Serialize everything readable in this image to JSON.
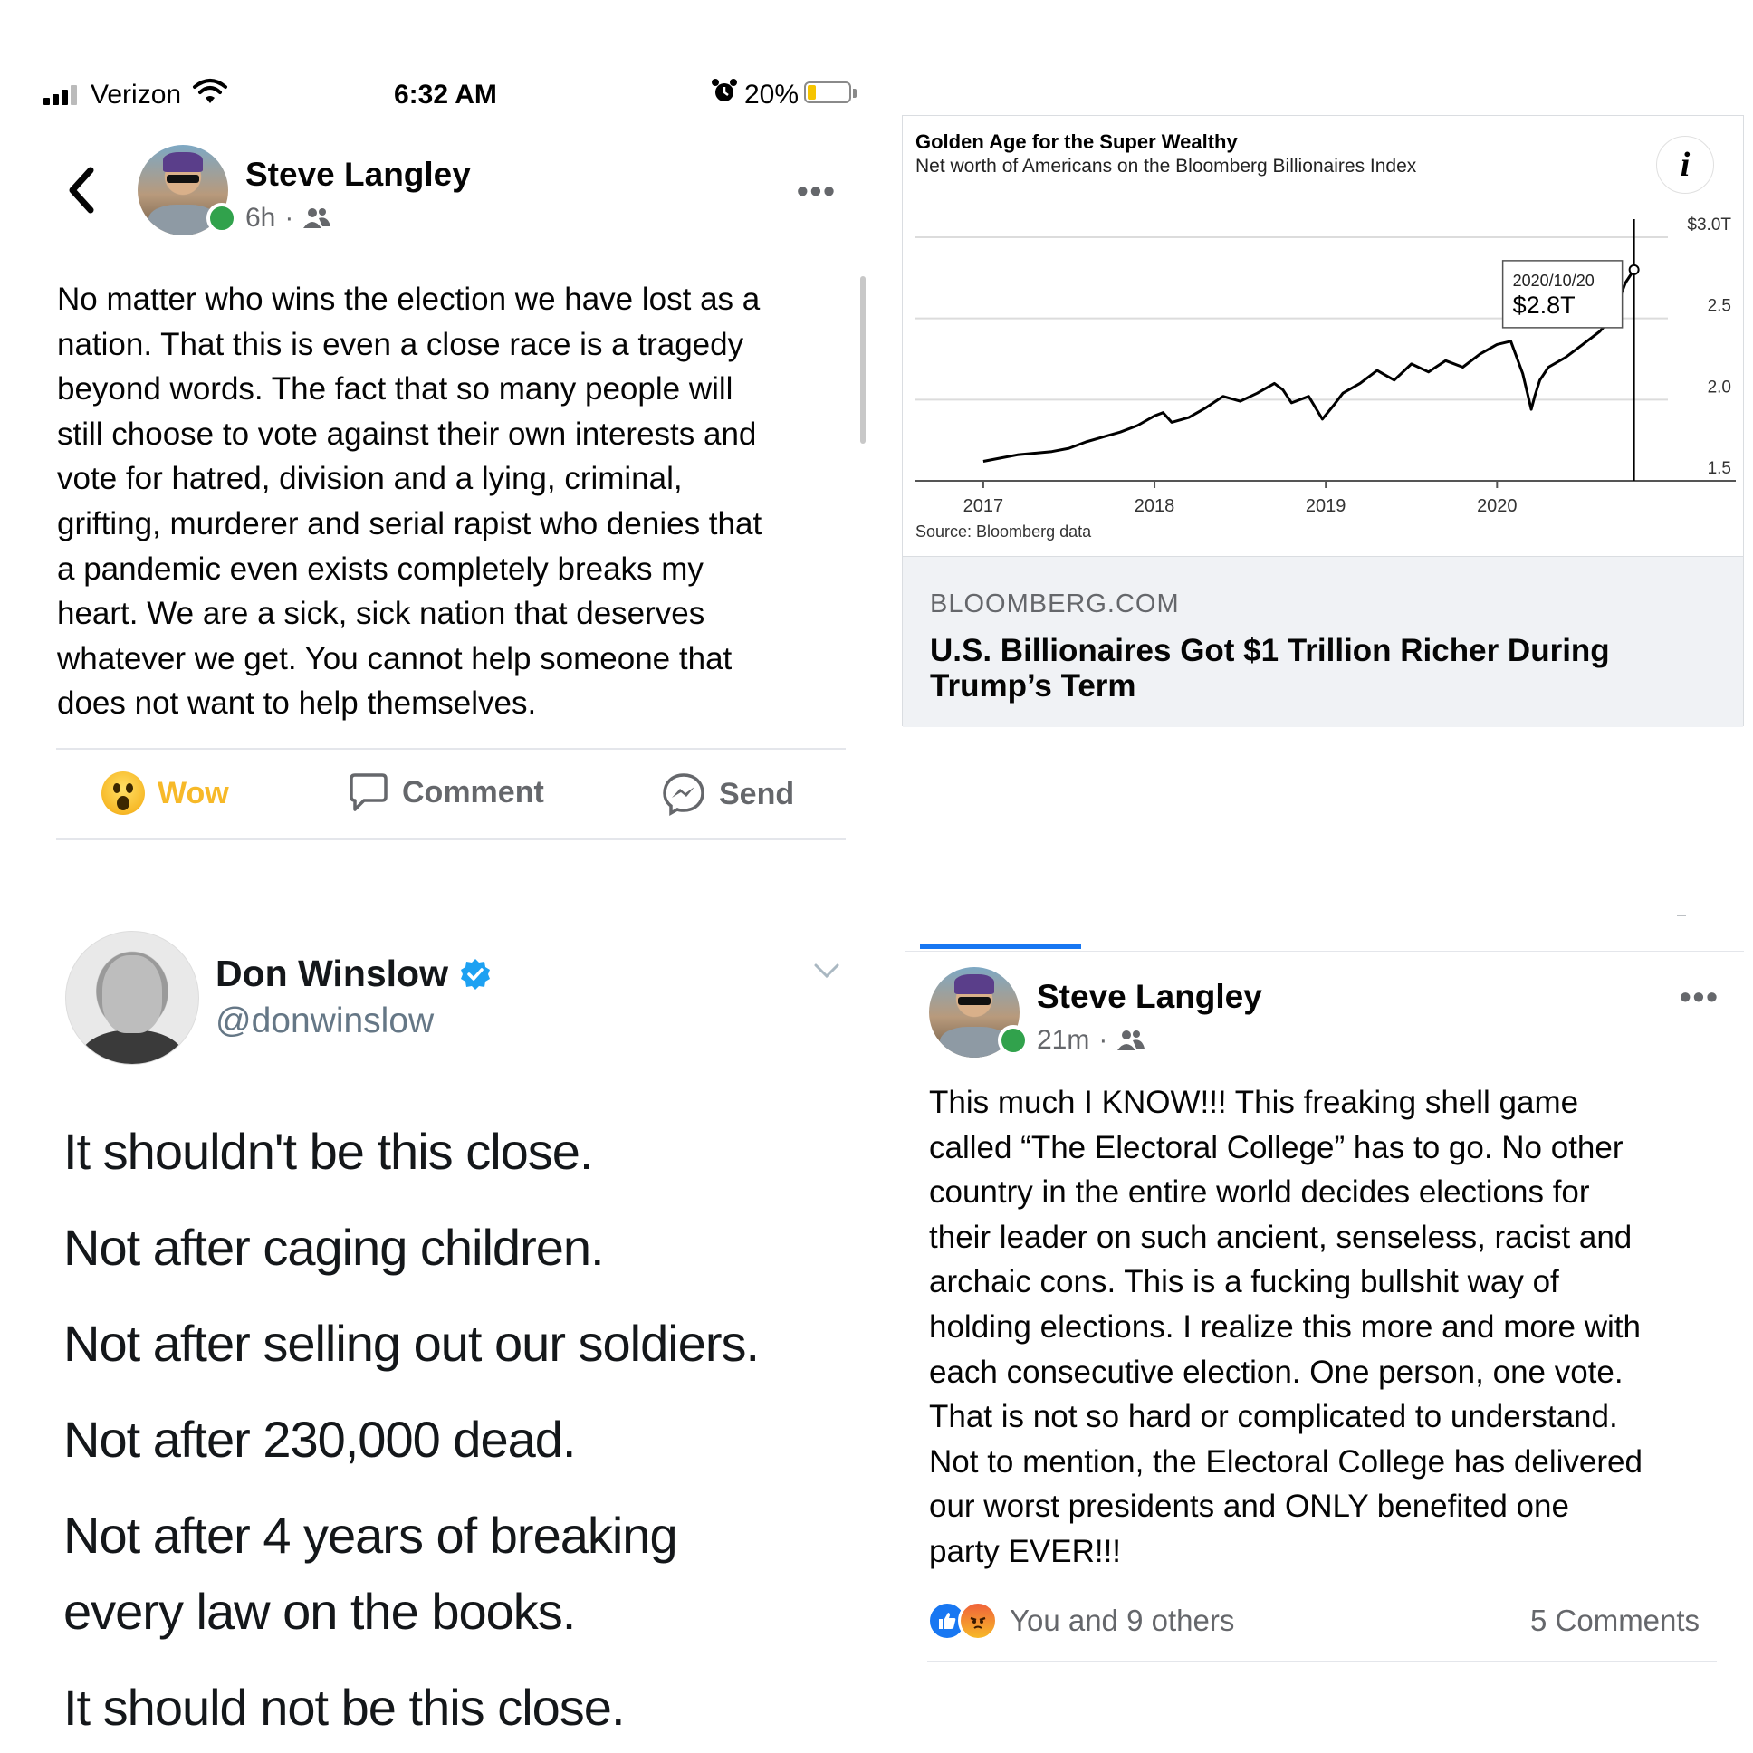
{
  "status_bar": {
    "carrier": "Verizon",
    "time": "6:32 AM",
    "battery": "20%",
    "battery_level": 0.2
  },
  "post1": {
    "author": "Steve Langley",
    "time": "6h",
    "privacy_icon": "friends-icon",
    "text": "No matter who wins the election we have lost as a nation. That this is even a close race is a tragedy beyond words. The fact that so many people will still choose to vote against their own interests and vote for hatred, division and a lying, criminal, grifting, murderer and serial rapist who denies that a pandemic even exists completely breaks my heart. We are a sick, sick nation that deserves whatever we get. You cannot help someone that does not want to help themselves.",
    "text_lines": [
      "No matter who wins the election we have lost as a",
      "nation. That this is even a close race is a tragedy",
      "beyond words. The fact that so many people will",
      "still choose to vote against their own interests and",
      "vote for hatred, division and a lying, criminal,",
      "grifting, murderer and serial rapist who denies that",
      "a pandemic even exists completely breaks my",
      "heart. We are a sick, sick nation that deserves",
      "whatever we get. You cannot help someone that",
      "does not want to help themselves."
    ],
    "actions": {
      "wow": "Wow",
      "comment": "Comment",
      "send": "Send"
    },
    "colors": {
      "wow": "#f7b928"
    }
  },
  "link_card": {
    "domain": "BLOOMBERG.COM",
    "headline_lines": [
      "U.S. Billionaires Got $1 Trillion Richer During",
      "Trump’s Term"
    ]
  },
  "chart_data": {
    "type": "line",
    "title": "Golden Age for the Super Wealthy",
    "subtitle": "Net worth of Americans on the Bloomberg Billionaires Index",
    "source": "Source: Bloomberg data",
    "x_ticks": [
      "2017",
      "2018",
      "2019",
      "2020"
    ],
    "y_ticks": [
      "$3.0T",
      "2.5",
      "2.0",
      "1.5"
    ],
    "y_tick_values": [
      3.0,
      2.5,
      2.0,
      1.5
    ],
    "ylim": [
      1.5,
      3.0
    ],
    "xlim": [
      2016.9,
      2020.95
    ],
    "tooltip": {
      "date": "2020/10/20",
      "value": "$2.8T"
    },
    "series": [
      {
        "x": [
          2017.0,
          2017.1,
          2017.2,
          2017.3,
          2017.4,
          2017.5,
          2017.6,
          2017.7,
          2017.8,
          2017.9,
          2018.0,
          2018.05,
          2018.1,
          2018.2,
          2018.3,
          2018.4,
          2018.5,
          2018.6,
          2018.7,
          2018.75,
          2018.8,
          2018.9,
          2018.98,
          2019.05,
          2019.1,
          2019.2,
          2019.3,
          2019.4,
          2019.5,
          2019.6,
          2019.7,
          2019.8,
          2019.9,
          2020.0,
          2020.08,
          2020.15,
          2020.2,
          2020.22,
          2020.25,
          2020.3,
          2020.4,
          2020.5,
          2020.6,
          2020.65,
          2020.7,
          2020.75,
          2020.8
        ],
        "y": [
          1.62,
          1.64,
          1.66,
          1.67,
          1.68,
          1.7,
          1.74,
          1.77,
          1.8,
          1.84,
          1.9,
          1.92,
          1.86,
          1.89,
          1.95,
          2.02,
          1.99,
          2.04,
          2.1,
          2.06,
          1.98,
          2.02,
          1.88,
          1.97,
          2.04,
          2.1,
          2.18,
          2.12,
          2.22,
          2.17,
          2.24,
          2.2,
          2.28,
          2.34,
          2.36,
          2.16,
          1.94,
          2.02,
          2.12,
          2.2,
          2.26,
          2.34,
          2.42,
          2.48,
          2.58,
          2.72,
          2.8
        ]
      }
    ]
  },
  "tweet": {
    "name": "Don Winslow",
    "handle": "@donwinslow",
    "lines": [
      "It shouldn't be this close.",
      "Not after caging children.",
      "Not after selling out our soldiers.",
      "Not after 230,000 dead.",
      "Not after 4 years of breaking",
      "every law on the books.",
      "It should not be this close."
    ]
  },
  "post2": {
    "author": "Steve Langley",
    "time": "21m",
    "text_lines": [
      "This much I KNOW!!! This freaking shell game",
      "called “The Electoral College” has to go. No other",
      "country in the entire world decides elections for",
      "their leader on such ancient, senseless, racist and",
      "archaic cons. This is a fucking bullshit way of",
      "holding elections. I realize this more and more with",
      "each consecutive election. One person, one vote.",
      "That is not so hard or complicated to understand.",
      "Not to mention, the Electoral College has delivered",
      "our worst presidents and ONLY benefited one",
      "party EVER!!!"
    ],
    "reactions_text": "You and 9 others",
    "comments": "5 Comments"
  }
}
